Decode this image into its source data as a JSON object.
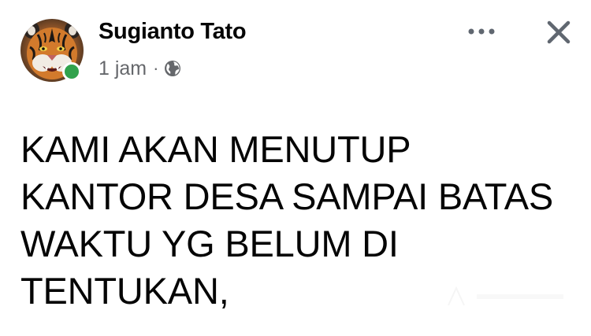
{
  "post": {
    "author_name": "Sugianto Tato",
    "timestamp": "1 jam",
    "separator": "·",
    "privacy_icon": "globe-icon",
    "avatar_icon": "tiger-face-avatar",
    "online_status_color": "#31a24c",
    "more_icon": "more-options-icon",
    "close_icon": "close-icon",
    "text_lines": [
      "KAMI AKAN MENUTUP",
      "KANTOR DESA SAMPAI BATAS",
      "WAKTU YG BELUM DI",
      "TENTUKAN,"
    ]
  },
  "colors": {
    "text_primary": "#050505",
    "text_secondary": "#65676b",
    "icon": "#606770",
    "background": "#ffffff",
    "online": "#31a24c"
  }
}
